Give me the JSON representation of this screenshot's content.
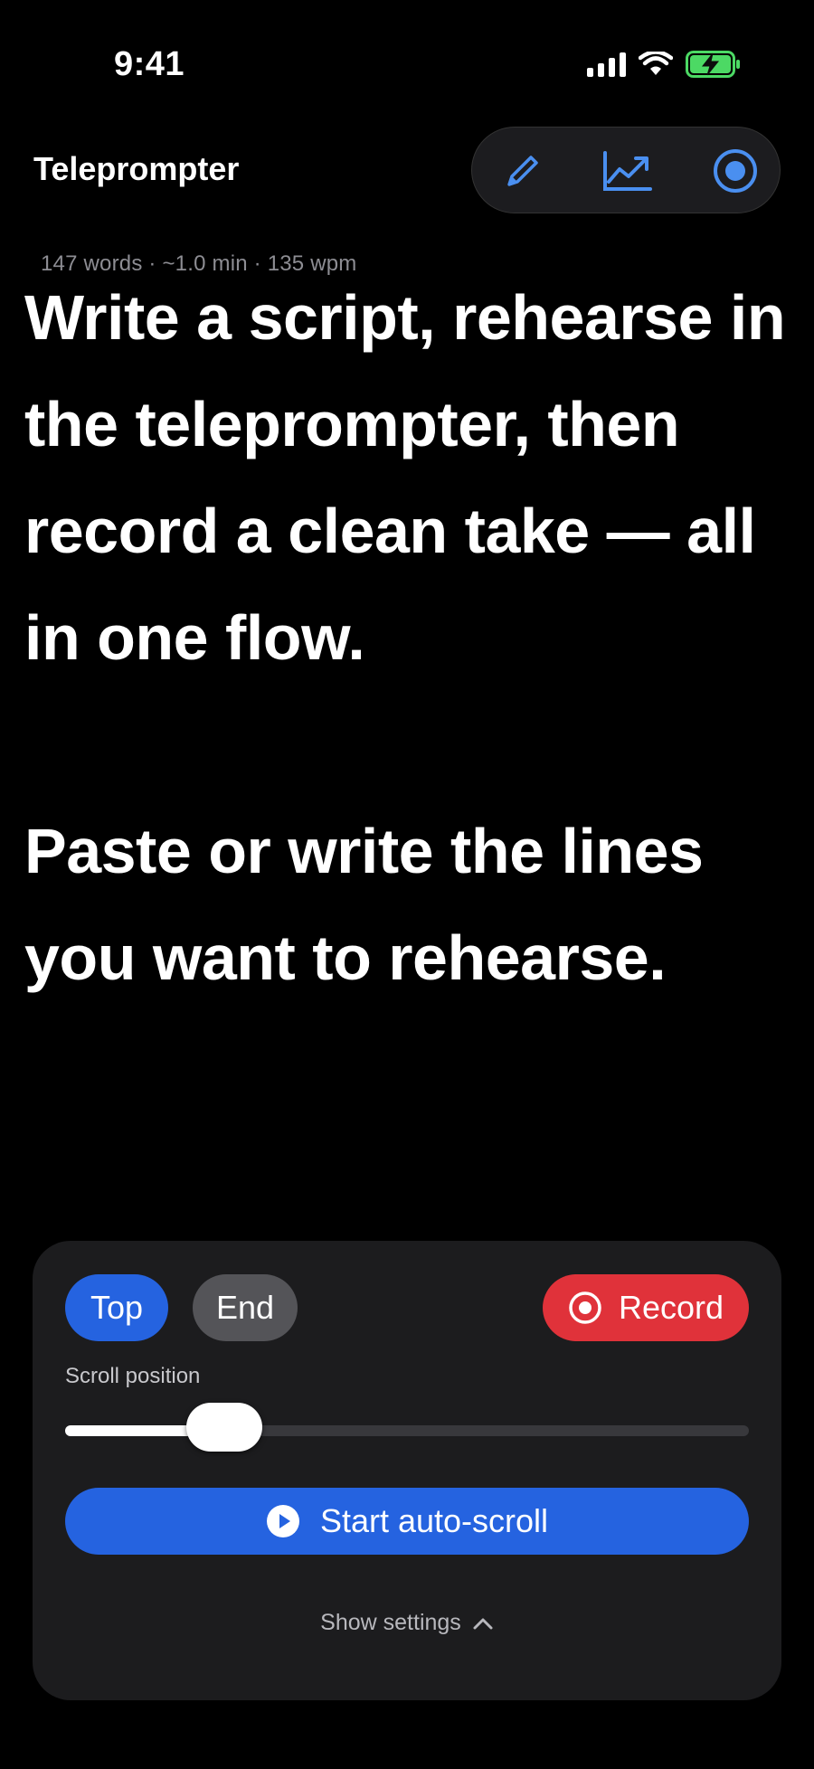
{
  "status_bar": {
    "time": "9:41",
    "battery_color": "#4cd964"
  },
  "header": {
    "title": "Teleprompter",
    "toolbar": [
      {
        "icon": "pencil-icon",
        "label": "Edit"
      },
      {
        "icon": "chart-trend-icon",
        "label": "Stats"
      },
      {
        "icon": "record-circle-icon",
        "label": "Record mode"
      }
    ],
    "accent_color": "#4a8ff0"
  },
  "stats": {
    "text": "147 words · ~1.0 min · 135 wpm"
  },
  "script": {
    "paragraphs": [
      "Write a script, rehearse in the teleprompter, then record a clean take — all in one flow.",
      "Paste or write the lines you want to rehearse."
    ]
  },
  "controls": {
    "top_label": "Top",
    "end_label": "End",
    "record_label": "Record",
    "scroll_position_label": "Scroll position",
    "scroll_position_value": 0.2,
    "autoscroll_label": "Start auto-scroll",
    "show_settings_label": "Show settings",
    "colors": {
      "primary": "#2563e0",
      "record": "#e0323a",
      "secondary": "#545458"
    }
  }
}
